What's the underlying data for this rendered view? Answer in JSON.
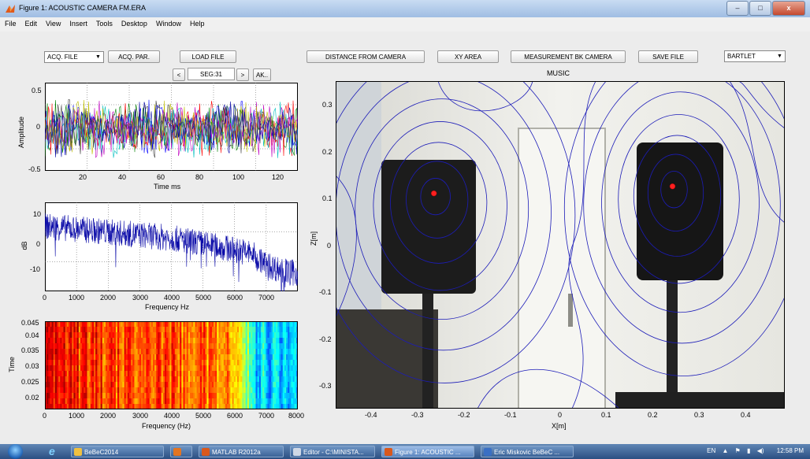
{
  "window": {
    "title": "Figure 1: ACOUSTIC CAMERA FM.ERA",
    "minimize": "–",
    "maximize": "□",
    "close": "x"
  },
  "menu": [
    "File",
    "Edit",
    "View",
    "Insert",
    "Tools",
    "Desktop",
    "Window",
    "Help"
  ],
  "controls": {
    "acq_file": "ACQ. FILE",
    "acq_par": "ACQ. PAR.",
    "load_file": "LOAD FILE",
    "prev": "<",
    "segment": "SEG:31",
    "next": ">",
    "ak": "AK..",
    "distance": "DISTANCE FROM CAMERA",
    "xy_area": "XY AREA",
    "measurement": "MEASUREMENT BK CAMERA",
    "save_file": "SAVE FILE",
    "method": "BARTLET"
  },
  "colors": {
    "accent_line": "#0a0aa8",
    "contour": "#1c1cb8",
    "marker": "#ff2020"
  },
  "chart_data": [
    {
      "type": "line",
      "title": "",
      "xlabel": "Time ms",
      "ylabel": "Amplitude",
      "xlim": [
        2,
        128
      ],
      "ylim": [
        -0.5,
        0.55
      ],
      "xticks": [
        "20",
        "40",
        "60",
        "80",
        "100",
        "120"
      ],
      "yticks": [
        "0.5",
        "0",
        "-0.5"
      ],
      "series_count": 8,
      "amplitude": 0.35
    },
    {
      "type": "line",
      "title": "",
      "xlabel": "Frequency Hz",
      "ylabel": "dB",
      "xlim": [
        0,
        8000
      ],
      "ylim": [
        -15,
        15
      ],
      "xticks": [
        "0",
        "1000",
        "2000",
        "3000",
        "4000",
        "5000",
        "6000",
        "7000"
      ],
      "yticks": [
        "10",
        "0",
        "-10"
      ],
      "envelope": [
        [
          0,
          7
        ],
        [
          1000,
          6
        ],
        [
          2000,
          5
        ],
        [
          3000,
          4
        ],
        [
          4000,
          3
        ],
        [
          5000,
          1
        ],
        [
          6000,
          -1
        ],
        [
          6500,
          -2
        ],
        [
          7000,
          -6
        ],
        [
          7500,
          -8
        ],
        [
          8000,
          -9
        ]
      ]
    },
    {
      "type": "heatmap",
      "title": "",
      "xlabel": "Frequency (Hz)",
      "ylabel": "Time",
      "xlim": [
        0,
        8000
      ],
      "ylim": [
        0.015,
        0.045
      ],
      "xticks": [
        "0",
        "1000",
        "2000",
        "3000",
        "4000",
        "5000",
        "6000",
        "7000",
        "8000"
      ],
      "yticks": [
        "0.045",
        "0.04",
        "0.035",
        "0.03",
        "0.025",
        "0.02"
      ],
      "colormap": "jet"
    },
    {
      "type": "contour",
      "title": "MUSIC",
      "xlabel": "X[m]",
      "ylabel": "Z[m]",
      "xlim": [
        -0.48,
        0.48
      ],
      "ylim": [
        -0.35,
        0.35
      ],
      "xticks": [
        "-0.4",
        "-0.3",
        "-0.2",
        "-0.1",
        "0",
        "0.1",
        "0.2",
        "0.3",
        "0.4"
      ],
      "yticks": [
        "0.3",
        "0.2",
        "0.1",
        "0",
        "-0.1",
        "-0.2",
        "-0.3"
      ],
      "sources": [
        {
          "x": -0.27,
          "z": 0.11
        },
        {
          "x": 0.24,
          "z": 0.125
        }
      ]
    }
  ],
  "taskbar": {
    "items": [
      "BeBeC2014",
      "",
      "MATLAB R2012a",
      "Editor - C:\\MINISTA...",
      "Figure 1: ACOUSTIC ...",
      "Eric Miskovic BeBeC ..."
    ],
    "lang": "EN",
    "clock": "12:58 PM"
  }
}
